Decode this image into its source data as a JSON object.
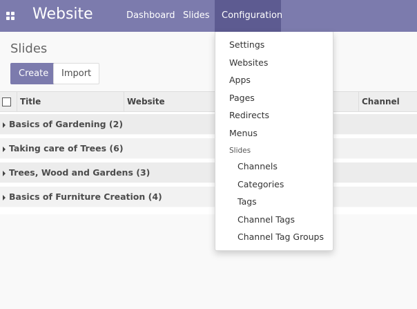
{
  "navbar": {
    "brand": "Website",
    "menu": [
      {
        "label": "Dashboard"
      },
      {
        "label": "Slides"
      },
      {
        "label": "Configuration"
      }
    ]
  },
  "control_panel": {
    "title": "Slides",
    "create_label": "Create",
    "import_label": "Import"
  },
  "list": {
    "columns": [
      {
        "label": "Title"
      },
      {
        "label": "Website"
      },
      {
        "label": "Channel"
      }
    ],
    "groups": [
      {
        "label": "Basics of Gardening (2)"
      },
      {
        "label": "Taking care of Trees (6)"
      },
      {
        "label": "Trees, Wood and Gardens (3)"
      },
      {
        "label": "Basics of Furniture Creation (4)"
      }
    ]
  },
  "dropdown": {
    "items": [
      {
        "label": "Settings"
      },
      {
        "label": "Websites"
      },
      {
        "label": "Apps"
      },
      {
        "label": "Pages"
      },
      {
        "label": "Redirects"
      },
      {
        "label": "Menus"
      }
    ],
    "section_header": "Slides",
    "sub_items": [
      {
        "label": "Channels"
      },
      {
        "label": "Categories"
      },
      {
        "label": "Tags"
      },
      {
        "label": "Channel Tags"
      },
      {
        "label": "Channel Tag Groups"
      }
    ]
  },
  "colors": {
    "navbar": "#7c7bad",
    "navbar_active": "#5d5b91",
    "primary_button": "#7c7bad"
  }
}
